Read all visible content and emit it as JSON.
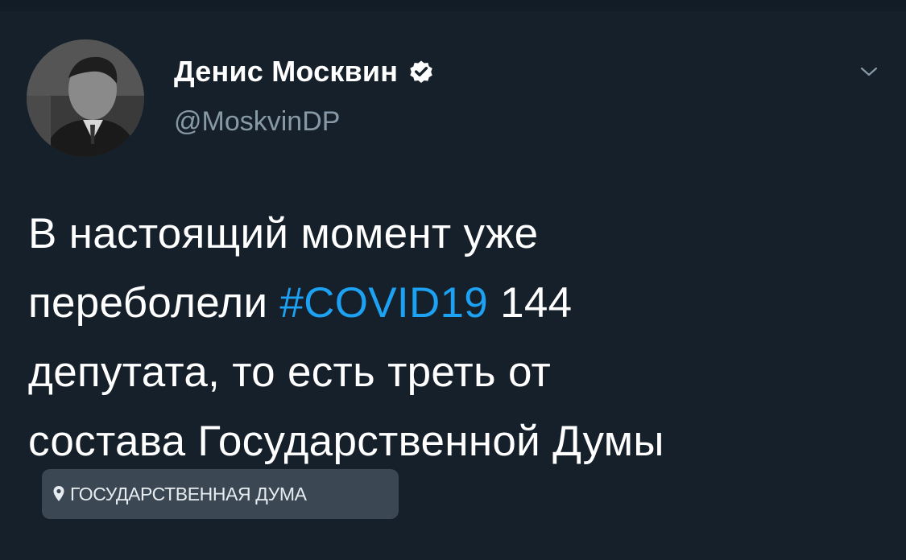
{
  "tweet": {
    "author": {
      "name": "Денис Москвин",
      "handle": "@MoskvinDP",
      "verified": true,
      "avatar_icon": "author-avatar-photo"
    },
    "menu_icon": "chevron-down-icon",
    "text_lines": [
      {
        "before": "В настоящий момент уже",
        "hashtag": "",
        "after": ""
      },
      {
        "before": "переболели ",
        "hashtag": "#COVID19",
        "after": " 144"
      },
      {
        "before": "депутата, то есть треть от",
        "hashtag": "",
        "after": ""
      },
      {
        "before": "состава Государственной Думы",
        "hashtag": "",
        "after": ""
      }
    ],
    "location": {
      "icon": "map-pin-icon",
      "label": "ГОСУДАРСТВЕННАЯ ДУМА"
    }
  },
  "colors": {
    "background": "#15202b",
    "text": "#ffffff",
    "secondary_text": "#8899a6",
    "accent": "#1da1f2",
    "chip_background": "#3b4853"
  }
}
